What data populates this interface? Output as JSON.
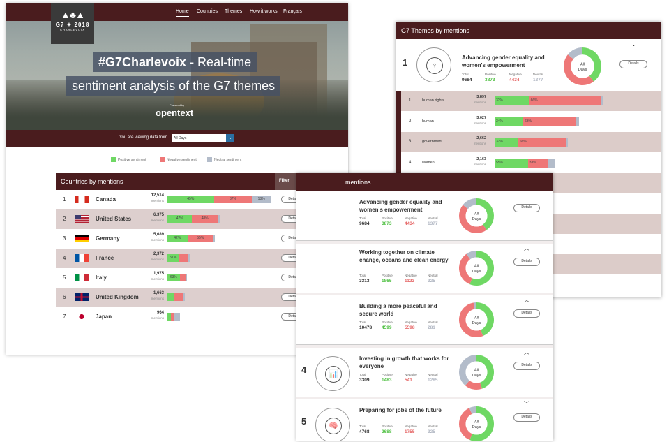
{
  "nav": {
    "logo_text": "G7 ✦ 2018",
    "logo_sub": "CHARLEVOIX",
    "items": [
      "Home",
      "Countries",
      "Themes",
      "How it works",
      "Français"
    ]
  },
  "hero": {
    "hashtag": "#G7Charlevoix",
    "title_rest": " - Real-time",
    "title_line2": "sentiment analysis of the G7 themes",
    "powered_by": "Powered by",
    "brand": "opentext"
  },
  "viewbar": {
    "label": "You are viewing data from",
    "selected": "All Days"
  },
  "legend": {
    "positive": "Positive sentiment",
    "negative": "Negative sentiment",
    "neutral": "Neutral sentiment"
  },
  "colors": {
    "positive": "#6fd864",
    "negative": "#ee7777",
    "neutral": "#b3bcca",
    "header": "#4a1c1e"
  },
  "countries": {
    "title": "Countries by mentions",
    "filter": "Filter",
    "mentions_label": "mentions",
    "details_label": "Details",
    "rows": [
      {
        "rank": "1",
        "name": "Canada",
        "mentions": "12,514",
        "pos": 45,
        "neg": 37,
        "neu": 18,
        "pos_label": "45%",
        "neg_label": "37%",
        "neu_label": "18%",
        "bar_frac": 1.0
      },
      {
        "rank": "2",
        "name": "United States",
        "mentions": "6,375",
        "pos": 47,
        "neg": 48,
        "neu": 5,
        "pos_label": "47%",
        "neg_label": "48%",
        "neu_label": "",
        "bar_frac": 0.51
      },
      {
        "rank": "3",
        "name": "Germany",
        "mentions": "5,689",
        "pos": 42,
        "neg": 55,
        "neu": 3,
        "pos_label": "42%",
        "neg_label": "55%",
        "neu_label": "",
        "bar_frac": 0.46
      },
      {
        "rank": "4",
        "name": "France",
        "mentions": "2,372",
        "pos": 51,
        "neg": 40,
        "neu": 9,
        "pos_label": "51%",
        "neg_label": "",
        "neu_label": "",
        "bar_frac": 0.22
      },
      {
        "rank": "5",
        "name": "Italy",
        "mentions": "1,975",
        "pos": 63,
        "neg": 30,
        "neu": 7,
        "pos_label": "63%",
        "neg_label": "",
        "neu_label": "",
        "bar_frac": 0.19
      },
      {
        "rank": "6",
        "name": "United Kingdom",
        "mentions": "1,663",
        "pos": 35,
        "neg": 55,
        "neu": 10,
        "pos_label": "",
        "neg_label": "",
        "neu_label": "",
        "bar_frac": 0.17
      },
      {
        "rank": "7",
        "name": "Japan",
        "mentions": "964",
        "pos": 30,
        "neg": 20,
        "neu": 50,
        "pos_label": "",
        "neg_label": "",
        "neu_label": "",
        "bar_frac": 0.12
      }
    ]
  },
  "themes_table": {
    "title": "G7 Themes by mentions",
    "top": {
      "rank": "1",
      "title": "Advancing gender equality and women's empowerment",
      "total": "9684",
      "positive": "3873",
      "negative": "4434",
      "neutral": "1377"
    },
    "stat_labels": {
      "total": "Total",
      "positive": "Positive",
      "negative": "Negative",
      "neutral": "Neutral"
    },
    "donut_label_1": "All",
    "donut_label_2": "Days",
    "details_label": "Details",
    "subrows": [
      {
        "rank": "1",
        "name": "human rights",
        "mentions": "3,897",
        "pos": 32,
        "neg": 66,
        "neu": 2,
        "pos_label": "32%",
        "neg_label": "66%",
        "bar_frac": 1.0
      },
      {
        "rank": "2",
        "name": "human",
        "mentions": "3,027",
        "pos": 34,
        "neg": 63,
        "neu": 3,
        "pos_label": "34%",
        "neg_label": "63%",
        "bar_frac": 0.78
      },
      {
        "rank": "3",
        "name": "government",
        "mentions": "2,662",
        "pos": 32,
        "neg": 66,
        "neu": 2,
        "pos_label": "32%",
        "neg_label": "66%",
        "bar_frac": 0.68
      },
      {
        "rank": "4",
        "name": "women",
        "mentions": "2,163",
        "pos": 55,
        "neg": 33,
        "neu": 12,
        "pos_label": "55%",
        "neg_label": "33%",
        "bar_frac": 0.56
      }
    ]
  },
  "theme_cards": {
    "title": "mentions",
    "cards": [
      {
        "rank": "",
        "title": "Advancing gender equality and women's empowerment",
        "total": "9684",
        "positive": "3873",
        "negative": "4434",
        "neutral": "1377",
        "chev": ""
      },
      {
        "rank": "",
        "title": "Working together on climate change, oceans and clean energy",
        "total": "3313",
        "positive": "1865",
        "negative": "1123",
        "neutral": "325",
        "chev": "^"
      },
      {
        "rank": "",
        "title": "Building a more peaceful and secure world",
        "total": "10478",
        "positive": "4599",
        "negative": "5598",
        "neutral": "281",
        "chev": "^"
      },
      {
        "rank": "4",
        "title": "Investing in growth that works for everyone",
        "total": "3309",
        "positive": "1483",
        "negative": "541",
        "neutral": "1285",
        "chev": "^"
      },
      {
        "rank": "5",
        "title": "Preparing for jobs of the future",
        "total": "4768",
        "positive": "2688",
        "negative": "1755",
        "neutral": "325",
        "chev": "v"
      }
    ]
  }
}
